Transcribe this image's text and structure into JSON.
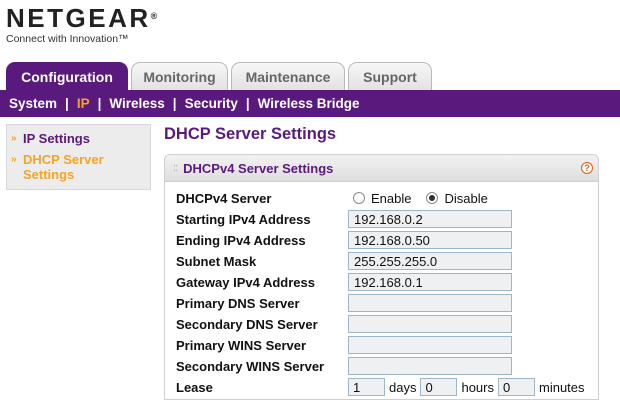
{
  "brand": {
    "name": "NETGEAR",
    "reg": "®",
    "tagline": "Connect with Innovation™"
  },
  "tabs": [
    {
      "label": "Configuration",
      "active": true
    },
    {
      "label": "Monitoring",
      "active": false
    },
    {
      "label": "Maintenance",
      "active": false
    },
    {
      "label": "Support",
      "active": false
    }
  ],
  "subnav": {
    "items": [
      "System",
      "IP",
      "Wireless",
      "Security",
      "Wireless Bridge"
    ],
    "separator": "|",
    "active": "IP"
  },
  "sidemenu": {
    "items": [
      {
        "label": "IP Settings",
        "active": false
      },
      {
        "label": "DHCP Server Settings",
        "active": true
      }
    ],
    "arrow": "»"
  },
  "page": {
    "title": "DHCP Server Settings"
  },
  "panel": {
    "title": "DHCPv4 Server Settings",
    "grip": "::",
    "help": "?"
  },
  "form": {
    "server": {
      "label": "DHCPv4 Server",
      "options": [
        "Enable",
        "Disable"
      ],
      "selected": "Disable"
    },
    "start_ip": {
      "label": "Starting IPv4 Address",
      "value": "192.168.0.2"
    },
    "end_ip": {
      "label": "Ending IPv4 Address",
      "value": "192.168.0.50"
    },
    "subnet": {
      "label": "Subnet Mask",
      "value": "255.255.255.0"
    },
    "gateway": {
      "label": "Gateway IPv4 Address",
      "value": "192.168.0.1"
    },
    "primary_dns": {
      "label": "Primary DNS Server",
      "value": ""
    },
    "secondary_dns": {
      "label": "Secondary DNS Server",
      "value": ""
    },
    "primary_wins": {
      "label": "Primary WINS Server",
      "value": ""
    },
    "secondary_wins": {
      "label": "Secondary WINS Server",
      "value": ""
    },
    "lease": {
      "label": "Lease",
      "days": "1",
      "days_unit": "days",
      "hours": "0",
      "hours_unit": "hours",
      "minutes": "0",
      "minutes_unit": "minutes"
    }
  },
  "colors": {
    "brand_purple": "#5a1a7d",
    "accent_orange": "#f4a523"
  }
}
